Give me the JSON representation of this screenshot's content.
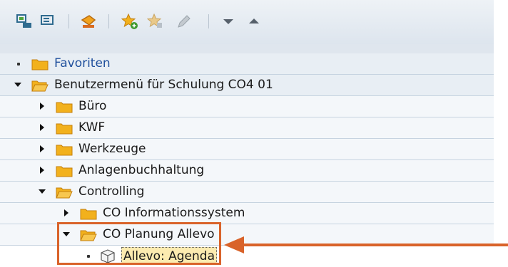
{
  "toolbar": {
    "icons": [
      "sap-menu-icon",
      "user-menu-icon",
      "delete-favorite-icon",
      "add-favorite-icon",
      "edit-favorite-icon",
      "edit-pencil-icon",
      "move-down-icon",
      "move-up-icon"
    ]
  },
  "tree": {
    "favorites": "Favoriten",
    "user_menu": "Benutzermenü für Schulung CO4 01",
    "buero": "Büro",
    "kwf": "KWF",
    "werkzeuge": "Werkzeuge",
    "anlagen": "Anlagenbuchhaltung",
    "controlling": "Controlling",
    "co_info": "CO Informationssystem",
    "co_planung": "CO Planung Allevo",
    "allevo_agenda": "Allevo: Agenda"
  },
  "colors": {
    "accent": "#d9632a",
    "folder": "#f2b11d",
    "link": "#1f4f9c",
    "selection": "#fcebb0"
  }
}
